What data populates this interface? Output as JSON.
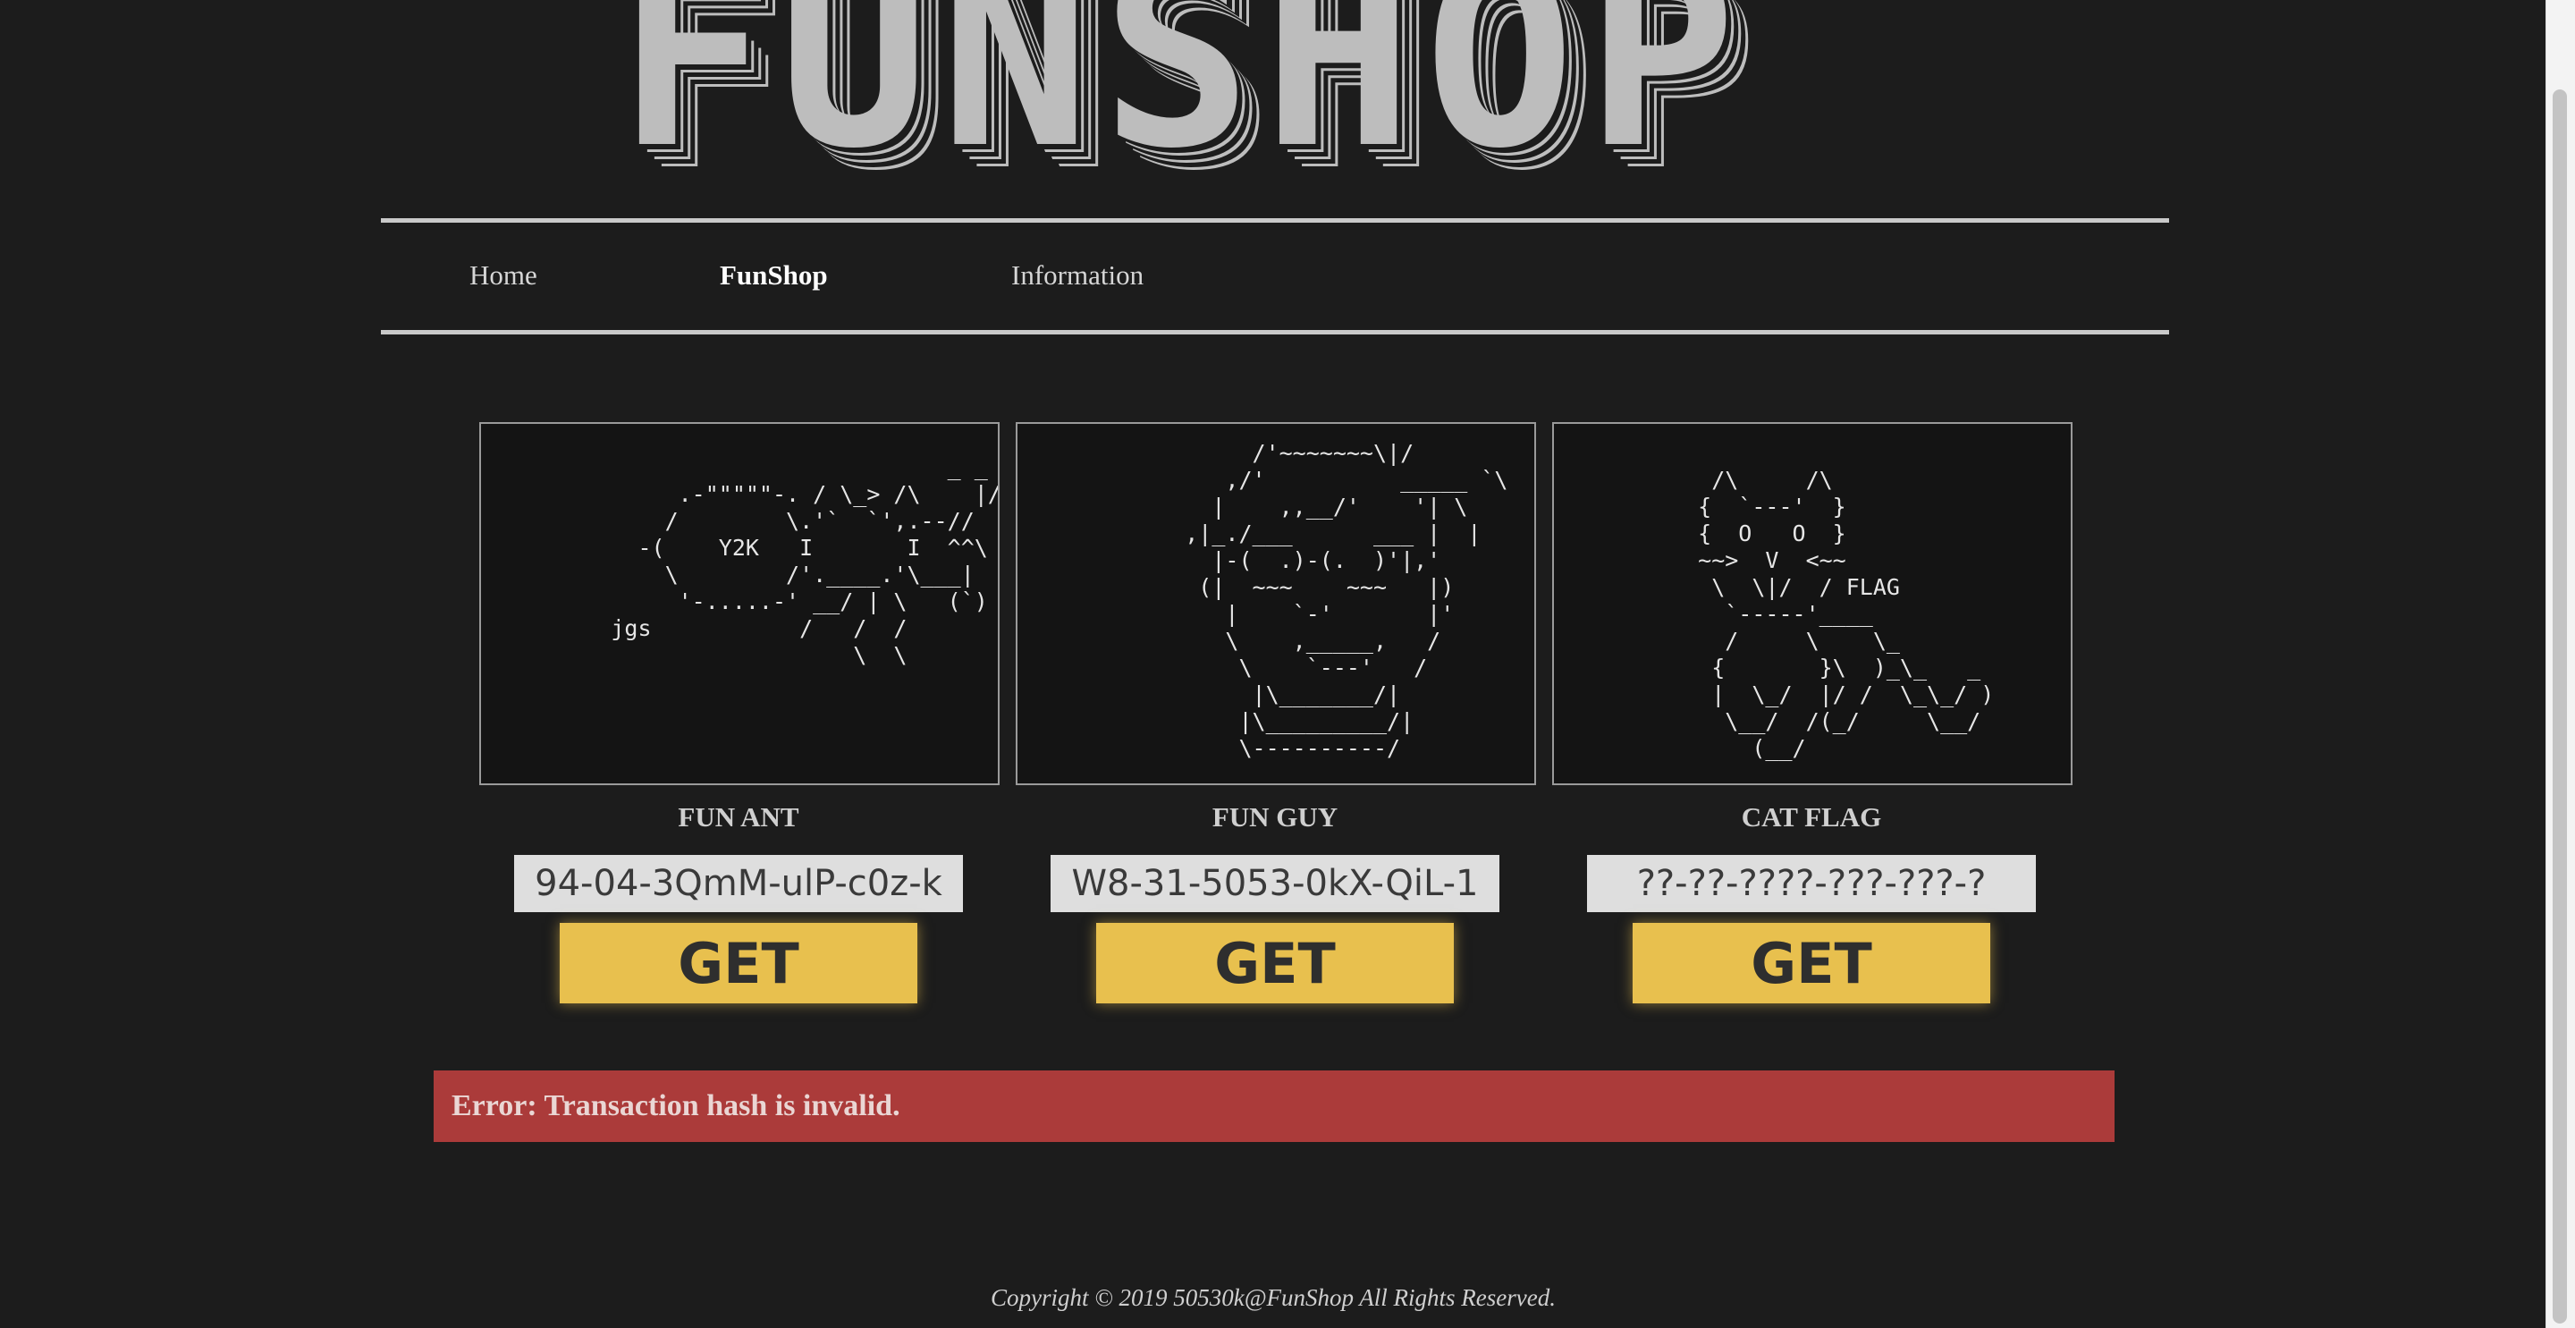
{
  "logo": {
    "text": "FUNSHOP"
  },
  "nav": {
    "items": [
      {
        "label": "Home"
      },
      {
        "label": "FunShop"
      },
      {
        "label": "Information"
      }
    ],
    "active": "FunShop"
  },
  "products": [
    {
      "name": "FUN ANT",
      "hash_value": "94-04-3QmM-ulP-c0z-k",
      "button_label": "GET",
      "ascii_art": "                                _ _             \\ \\\n            .-\"\"\"\"\"-. / \\_> /\\    |/\n           /        \\.'`  `',.--//\n         -(    Y2K   I       I  ^^\\\n           \\        /'.____.'\\___|\n            '-.....-' __/ | \\   (`)\n       jgs           /   /  /\n                         \\  \\"
    },
    {
      "name": "FUN GUY",
      "hash_value": "W8-31-5053-0kX-QiL-1",
      "button_label": "GET",
      "ascii_art": "          /'~~~~~~~\\|/\n        ,/'          _____ `\\\n       |    ,,__/'    '| \\\n     ,|_./___      ___ |  |\n       |-(  .)-(.  )'|,'\n      (|  ~~~    ~~~   |)\n        |    `-'       |'\n        \\    ,_____,   /\n         \\    `---'   /\n          |\\_______/|\n         |\\_________/|\n         \\----------/"
    },
    {
      "name": "CAT FLAG",
      "hash_value": "??-??-????-???-???-?",
      "button_label": "GET",
      "ascii_art": "    /\\     /\\\n   {  `---'  }\n   {  O   O  }\n   ~~>  V  <~~\n    \\  \\|/  / FLAG\n     `-----'____\n     /     \\    \\_\n    {       }\\  )_\\_   _\n    |  \\_/  |/ /  \\_\\_/ )\n     \\__/  /(_/     \\__/\n       (__/"
    }
  ],
  "error": {
    "message": "Error: Transaction hash is invalid."
  },
  "footer": {
    "text": "Copyright © 2019 50530k@FunShop All Rights Reserved."
  },
  "colors": {
    "background": "#1c1c1c",
    "button": "#e8c04e",
    "error": "#ab3b3a",
    "nav_border": "#c9c9c9"
  }
}
